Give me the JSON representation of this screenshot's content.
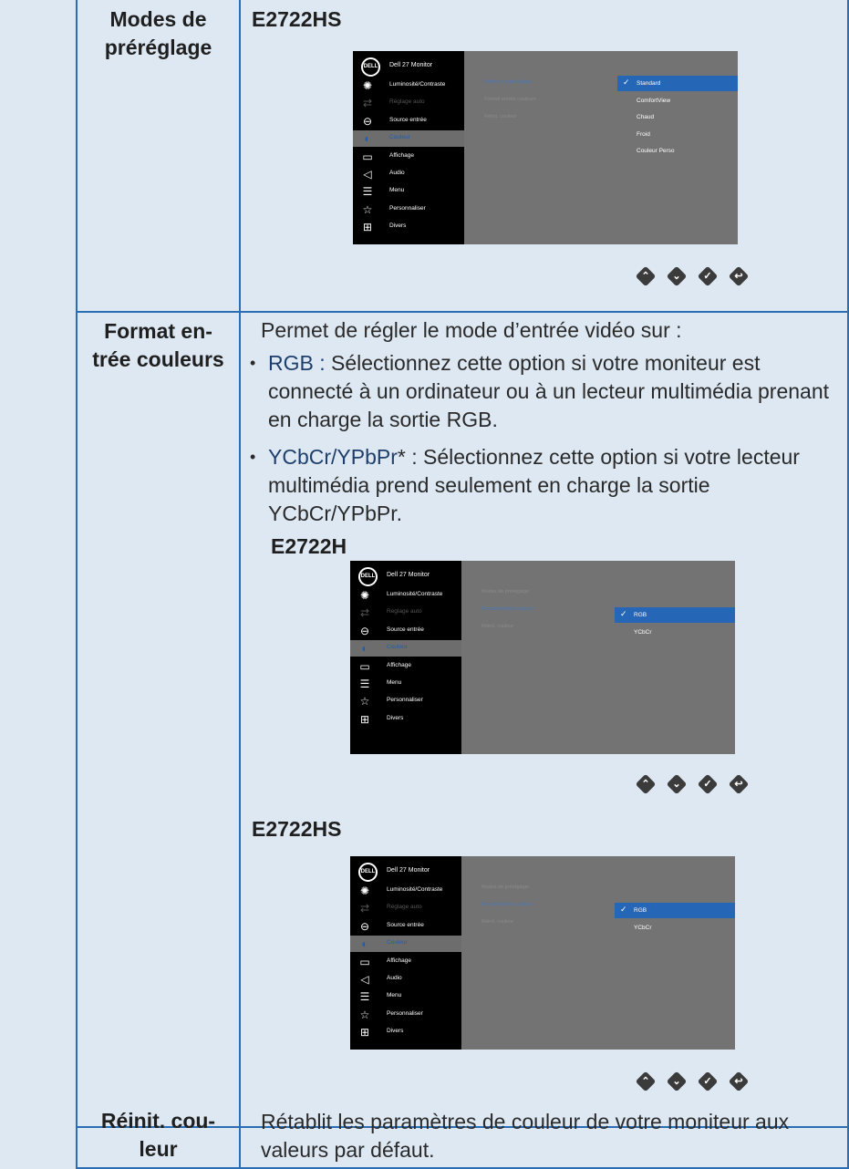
{
  "rows": [
    {
      "label": "Modes de\npréréglage"
    },
    {
      "label": "Format en-\ntrée couleurs"
    },
    {
      "label": "Réinit. cou-\nleur"
    }
  ],
  "row1": {
    "model": "E2722HS"
  },
  "row2": {
    "intro": "Permet de régler le mode d’entrée vidéo sur :",
    "b1_term": "RGB :",
    "b1_text": " Sélectionnez cette option si votre moniteur est connecté à un ordinateur ou à un lecteur multimédia prenant en charge la sortie RGB.",
    "b2_term": "YCbCr/YPbPr",
    "b2_star": "* :",
    "b2_text": " Sélectionnez cette option si votre lecteur multimédia prend seulement en charge la sortie YCbCr/YPbPr.",
    "model_a": "E2722H",
    "model_b": "E2722HS"
  },
  "row3": {
    "text": "Rétablit les paramètres de couleur de votre moniteur aux valeurs par défaut."
  },
  "osd": {
    "title": "Dell 27 Monitor",
    "logo": "DELL",
    "menu_full": [
      "Luminosité/Contraste",
      "Réglage auto",
      "Source entrée",
      "Couleur",
      "Affichage",
      "Audio",
      "Menu",
      "Personnaliser",
      "Divers"
    ],
    "menu_h": [
      "Luminosité/Contraste",
      "Réglage auto",
      "Source entrée",
      "Couleur",
      "Affichage",
      "Menu",
      "Personnaliser",
      "Divers"
    ],
    "sub": [
      "Modes de préréglage",
      "Format entrée couleurs",
      "Réinit. couleur"
    ],
    "opts_preset": [
      "Standard",
      "ComfortView",
      "Chaud",
      "Froid",
      "Couleur Perso"
    ],
    "opts_format": [
      "RGB",
      "YCbCr"
    ]
  },
  "icons": {
    "menu_full": [
      "sun-icon",
      "auto-adjust-icon",
      "input-source-icon",
      "color-icon",
      "display-icon",
      "audio-icon",
      "menu-icon",
      "star-icon",
      "others-icon"
    ],
    "menu_h": [
      "sun-icon",
      "auto-adjust-icon",
      "input-source-icon",
      "color-icon",
      "display-icon",
      "menu-icon",
      "star-icon",
      "others-icon"
    ],
    "buttons": [
      "up-button-icon",
      "down-button-icon",
      "check-button-icon",
      "back-button-icon"
    ]
  },
  "colors": {
    "border": "#2a6db4",
    "background": "#dde8f3",
    "osd_highlight": "#2566b6"
  }
}
